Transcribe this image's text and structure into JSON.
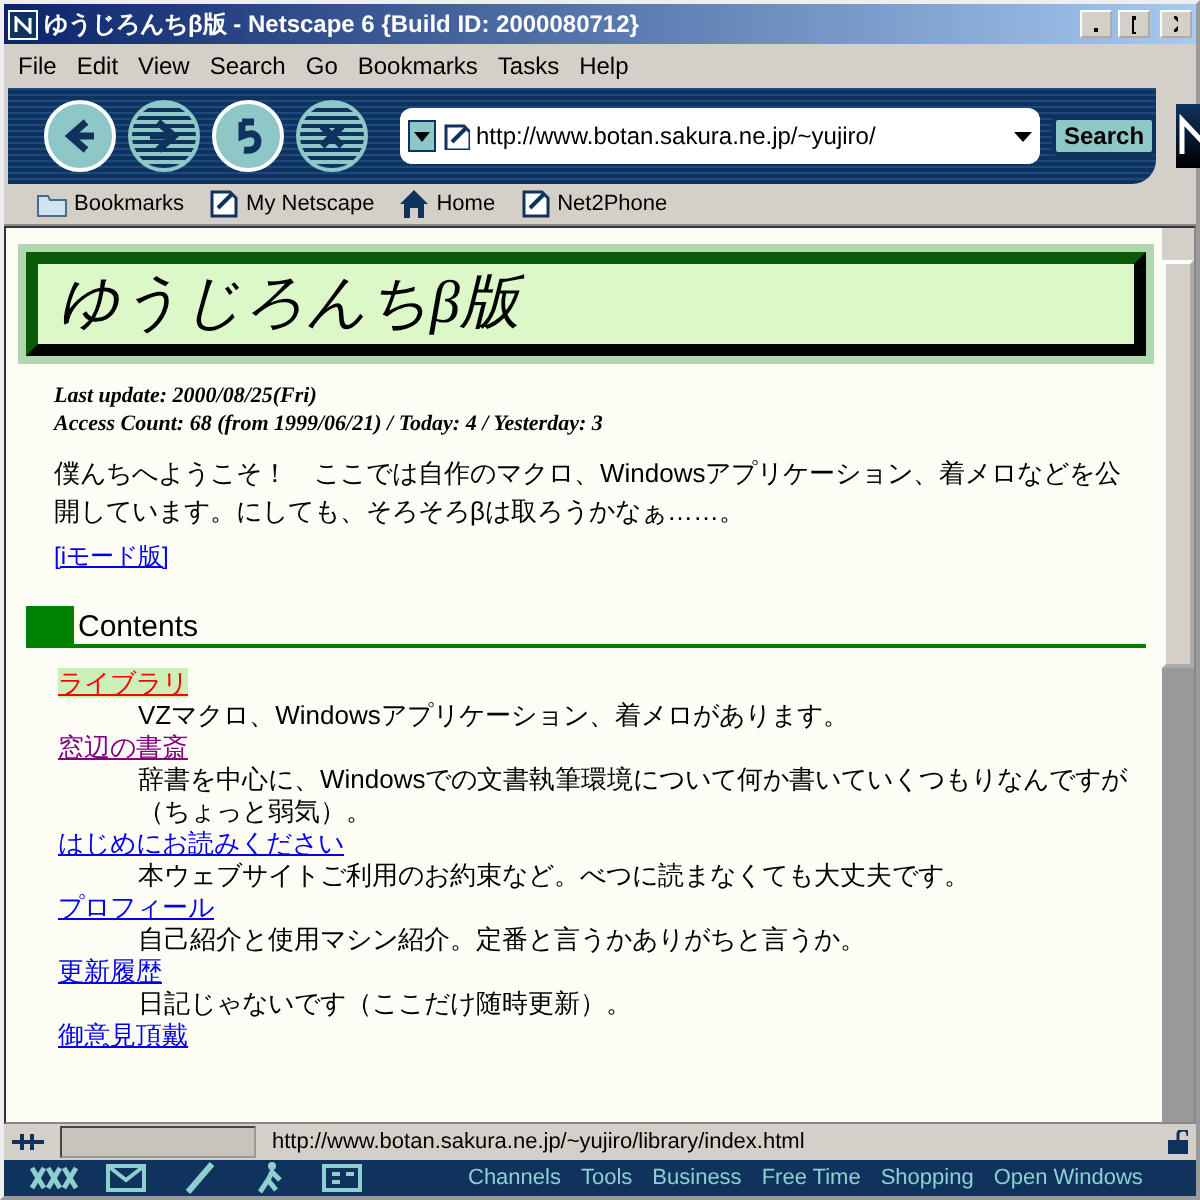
{
  "window": {
    "title": "ゆうじろんちβ版 - Netscape 6 {Build ID: 2000080712}"
  },
  "menu": [
    "File",
    "Edit",
    "View",
    "Search",
    "Go",
    "Bookmarks",
    "Tasks",
    "Help"
  ],
  "nav_buttons": [
    {
      "kind": "back",
      "disabled": false
    },
    {
      "kind": "forward",
      "disabled": true
    },
    {
      "kind": "reload",
      "disabled": false
    },
    {
      "kind": "stop",
      "disabled": true
    }
  ],
  "address": {
    "value": "http://www.botan.sakura.ne.jp/~yujiro/"
  },
  "search_button": "Search",
  "personal_toolbar": [
    {
      "kind": "folder",
      "label": "Bookmarks"
    },
    {
      "kind": "page",
      "label": "My Netscape"
    },
    {
      "kind": "home",
      "label": "Home"
    },
    {
      "kind": "page",
      "label": "Net2Phone"
    }
  ],
  "page": {
    "heading": "ゆうじろんちβ版",
    "meta": [
      "Last update: 2000/08/25(Fri)",
      "Access Count: 68 (from 1999/06/21) / Today: 4 / Yesterday: 3"
    ],
    "intro": "僕んちへようこそ！　ここでは自作のマクロ、Windowsアプリケーション、着メロなどを公開しています。にしても、そろそろβは取ろうかなぁ……。",
    "mode_link": "[iモード版]",
    "section": "Contents",
    "items": [
      {
        "link": "ライブラリ",
        "hovered": true,
        "visited": false,
        "description": "VZマクロ、Windowsアプリケーション、着メロがあります。"
      },
      {
        "link": "窓辺の書斎",
        "hovered": false,
        "visited": true,
        "description": "辞書を中心に、Windowsでの文書執筆環境について何か書いていくつもりなんですが（ちょっと弱気）。"
      },
      {
        "link": "はじめにお読みください",
        "hovered": false,
        "visited": false,
        "description": "本ウェブサイトご利用のお約束など。べつに読まなくても大丈夫です。"
      },
      {
        "link": "プロフィール",
        "hovered": false,
        "visited": false,
        "description": "自己紹介と使用マシン紹介。定番と言うかありがちと言うか。"
      },
      {
        "link": "更新履歴",
        "hovered": false,
        "visited": false,
        "description": "日記じゃないです（ここだけ随時更新）。"
      },
      {
        "link": "御意見頂戴",
        "hovered": false,
        "visited": false
      }
    ]
  },
  "status_bar": {
    "url": "http://www.botan.sakura.ne.jp/~yujiro/library/index.html"
  },
  "taskbar": {
    "links": [
      "Channels",
      "Tools",
      "Business",
      "Free Time",
      "Shopping",
      "Open Windows"
    ]
  }
}
